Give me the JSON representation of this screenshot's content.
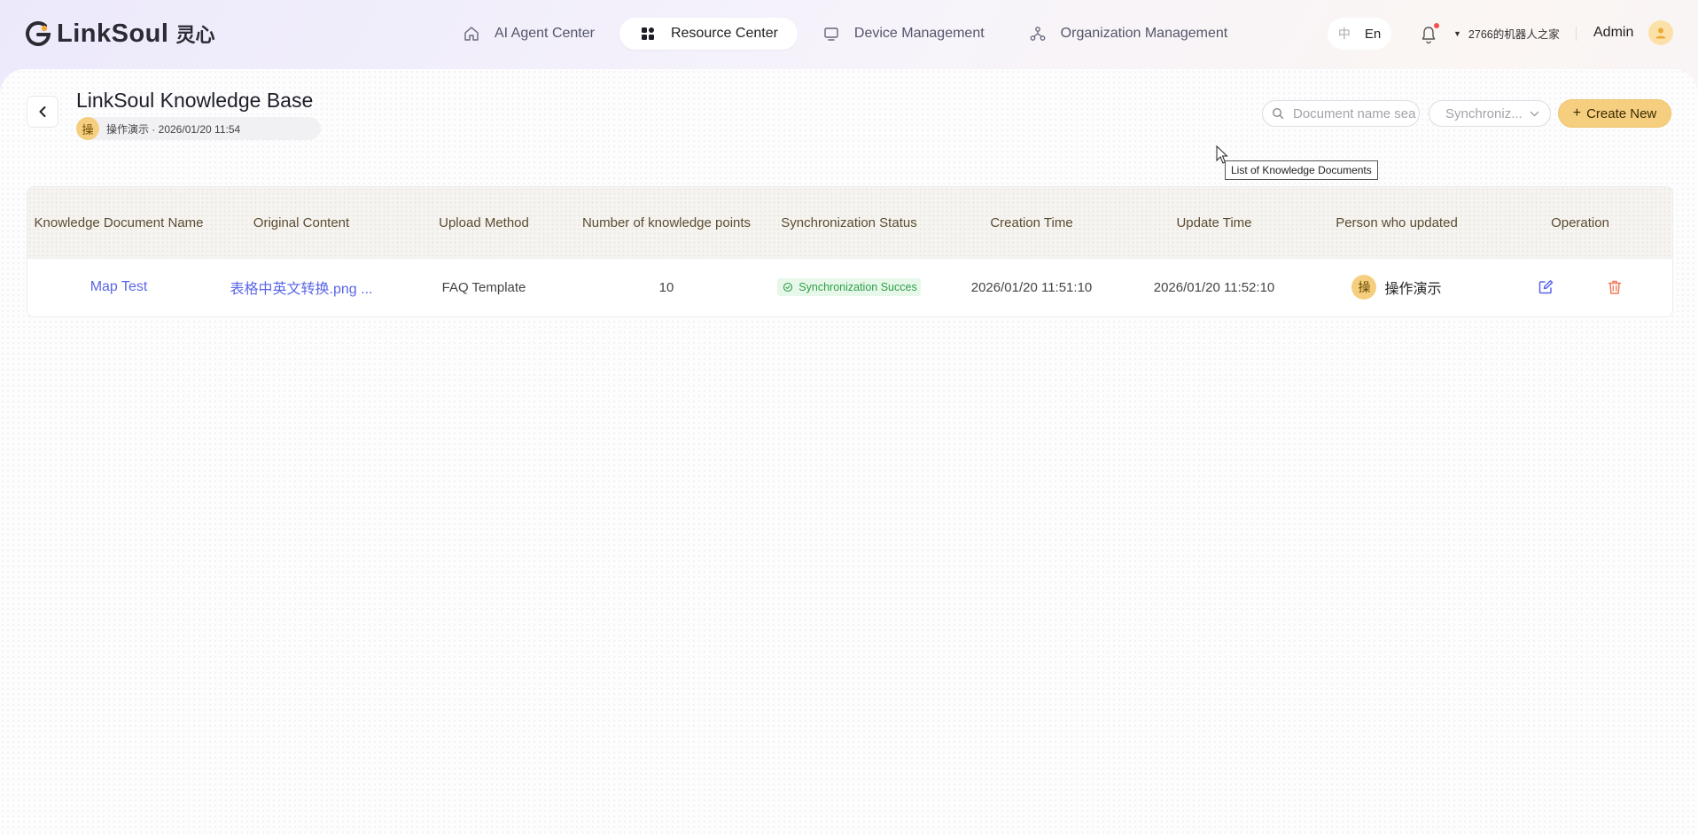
{
  "brand": {
    "name": "LinkSoul",
    "name_cn": "灵心"
  },
  "nav": {
    "items": [
      {
        "label": "AI Agent Center",
        "icon": "home-icon",
        "active": false
      },
      {
        "label": "Resource Center",
        "icon": "grid-icon",
        "active": true
      },
      {
        "label": "Device Management",
        "icon": "monitor-icon",
        "active": false
      },
      {
        "label": "Organization Management",
        "icon": "org-tree-icon",
        "active": false
      }
    ]
  },
  "header": {
    "lang_zh": "中",
    "lang_en": "En",
    "org_name": "2766的机器人之家",
    "user_name": "Admin"
  },
  "page": {
    "title": "LinkSoul Knowledge Base",
    "author_initial": "操",
    "meta": "操作演示 · 2026/01/20 11:54"
  },
  "toolbar": {
    "search_placeholder": "Document name sea",
    "sync_placeholder": "Synchroniz...",
    "create_label": "Create New",
    "create_plus": "+"
  },
  "tooltip": "List of Knowledge Documents",
  "table": {
    "columns": [
      "Knowledge Document Name",
      "Original Content",
      "Upload Method",
      "Number of knowledge points",
      "Synchronization Status",
      "Creation Time",
      "Update Time",
      "Person who updated",
      "Operation"
    ],
    "rows": [
      {
        "name": "Map Test",
        "original": "表格中英文转换.png ...",
        "upload_method": "FAQ Template",
        "points": "10",
        "status": "Synchronization Succes",
        "created": "2026/01/20 11:51:10",
        "updated": "2026/01/20 11:52:10",
        "person_initial": "操",
        "person": "操作演示"
      }
    ]
  },
  "colors": {
    "accent": "#f5cf7f",
    "link": "#5a66e6",
    "success": "#2f9e48",
    "danger": "#f07a5a"
  }
}
